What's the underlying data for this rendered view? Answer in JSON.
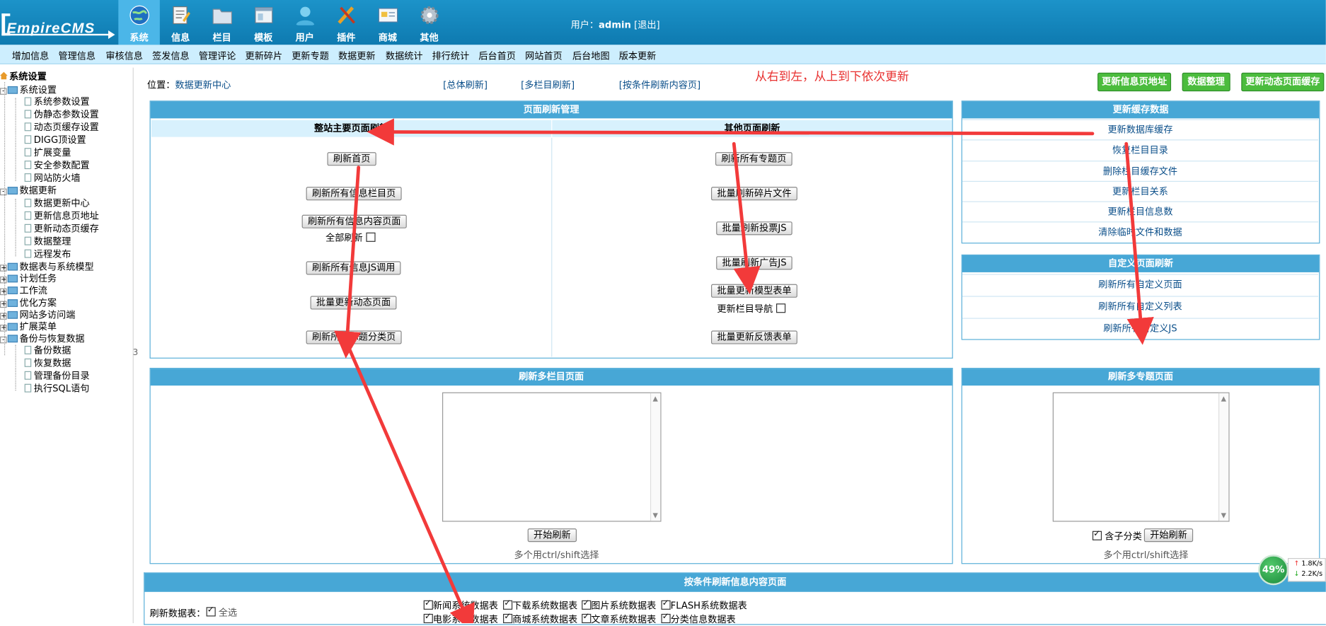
{
  "header": {
    "logo_text": "EmpireCMS",
    "nav": [
      {
        "label": "系统",
        "icon": "globe-icon",
        "active": true
      },
      {
        "label": "信息",
        "icon": "notepad-icon",
        "active": false
      },
      {
        "label": "栏目",
        "icon": "folder-icon",
        "active": false
      },
      {
        "label": "模板",
        "icon": "template-icon",
        "active": false
      },
      {
        "label": "用户",
        "icon": "user-icon",
        "active": false
      },
      {
        "label": "插件",
        "icon": "tools-icon",
        "active": false
      },
      {
        "label": "商城",
        "icon": "shop-icon",
        "active": false
      },
      {
        "label": "其他",
        "icon": "gear-icon",
        "active": false
      }
    ],
    "user_prefix": "用户：",
    "username": "admin",
    "logout": "[退出]"
  },
  "submenu": [
    "增加信息",
    "管理信息",
    "审核信息",
    "签发信息",
    "管理评论",
    "更新碎片",
    "更新专题",
    "数据更新",
    "数据统计",
    "排行统计",
    "后台首页",
    "网站首页",
    "后台地图",
    "版本更新"
  ],
  "sidebar": {
    "root": "系统设置",
    "groups": [
      {
        "label": "系统设置",
        "children": [
          "系统参数设置",
          "伪静态参数设置",
          "动态页缓存设置",
          "DIGG顶设置",
          "扩展变量",
          "安全参数配置",
          "网站防火墙"
        ]
      },
      {
        "label": "数据更新",
        "children": [
          "数据更新中心",
          "更新信息页地址",
          "更新动态页缓存",
          "数据整理",
          "远程发布"
        ]
      },
      {
        "label": "数据表与系统模型",
        "children": []
      },
      {
        "label": "计划任务",
        "children": []
      },
      {
        "label": "工作流",
        "children": []
      },
      {
        "label": "优化方案",
        "children": []
      },
      {
        "label": "网站多访问端",
        "children": []
      },
      {
        "label": "扩展菜单",
        "children": []
      },
      {
        "label": "备份与恢复数据",
        "children": [
          "备份数据",
          "恢复数据",
          "管理备份目录",
          "执行SQL语句"
        ]
      }
    ],
    "scroll_mark": "3"
  },
  "location": {
    "prefix": "位置：",
    "current": "数据更新中心"
  },
  "top_links": [
    "[总体刷新]",
    "[多栏目刷新]",
    "[按条件刷新内容页]"
  ],
  "annotation": "从右到左，从上到下依次更新",
  "top_buttons": [
    "更新信息页地址",
    "数据整理",
    "更新动态页面缓存"
  ],
  "page_refresh": {
    "title": "页面刷新管理",
    "left_head": "整站主要页面刷新",
    "right_head": "其他页面刷新",
    "left_buttons": [
      "刷新首页",
      "刷新所有信息栏目页",
      "刷新所有信息内容页面",
      "刷新所有信息JS调用",
      "批量更新动态页面",
      "刷新所有标题分类页"
    ],
    "full_refresh_label": "全部刷新",
    "right_buttons": [
      "刷新所有专题页",
      "批量刷新碎片文件",
      "批量刷新投票JS",
      "批量刷新广告JS",
      "批量更新模型表单",
      "批量更新反馈表单"
    ],
    "nav_update_label": "更新栏目导航"
  },
  "cache_panel": {
    "title": "更新缓存数据",
    "items": [
      "更新数据库缓存",
      "恢复栏目目录",
      "删除栏目缓存文件",
      "更新栏目关系",
      "更新栏目信息数",
      "清除临时文件和数据"
    ]
  },
  "custom_panel": {
    "title": "自定义页面刷新",
    "items": [
      "刷新所有自定义页面",
      "刷新所有自定义列表",
      "刷新所有自定义JS"
    ]
  },
  "multi_column": {
    "title": "刷新多栏目页面",
    "button": "开始刷新",
    "hint": "多个用ctrl/shift选择"
  },
  "multi_topic": {
    "title": "刷新多专题页面",
    "include_sub": "含子分类",
    "button": "开始刷新",
    "hint": "多个用ctrl/shift选择"
  },
  "condition": {
    "title": "按条件刷新信息内容页面",
    "table_label": "刷新数据表：",
    "select_all": "全选",
    "tables": [
      "新闻系统数据表",
      "下载系统数据表",
      "图片系统数据表",
      "FLASH系统数据表",
      "电影系统数据表",
      "商城系统数据表",
      "文章系统数据表",
      "分类信息数据表"
    ]
  },
  "speed": {
    "percent": "49%",
    "up": "1.8K/s",
    "down": "2.2K/s"
  },
  "colors": {
    "header": "#1487be",
    "accent": "#47a7d6",
    "annotation": "#e8302f",
    "green_button": "#4bbc3d"
  }
}
